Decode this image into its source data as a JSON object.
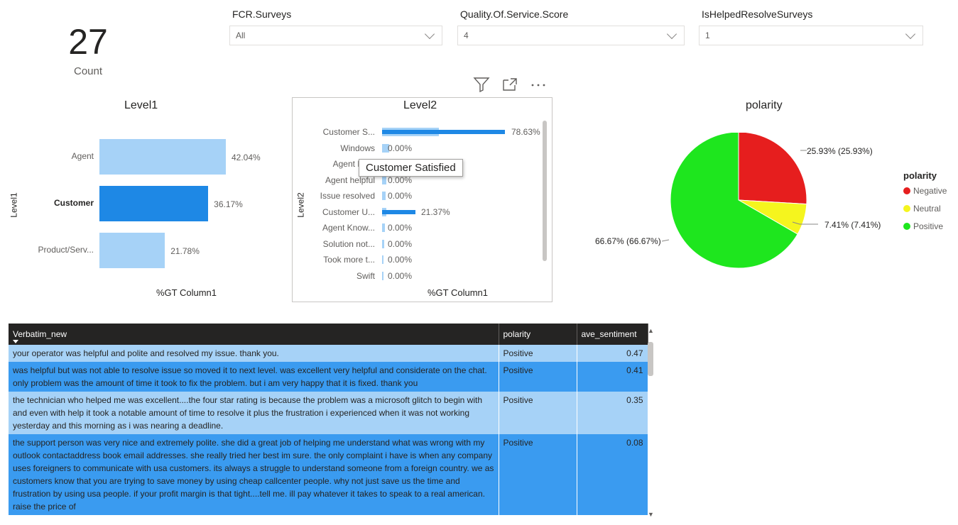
{
  "kpi": {
    "value": "27",
    "label": "Count"
  },
  "slicers": [
    {
      "title": "FCR.Surveys",
      "value": "All"
    },
    {
      "title": "Quality.Of.Service.Score",
      "value": "4"
    },
    {
      "title": "IsHelpedResolveSurveys",
      "value": "1"
    }
  ],
  "visual_header": {
    "icons": [
      "filter-icon",
      "focus-mode-icon",
      "more-options-icon"
    ]
  },
  "colors": {
    "bar_light": "#a6d2f7",
    "bar_highlight": "#1e88e5",
    "negative": "#e61e1e",
    "neutral": "#f5f51e",
    "positive": "#1ee61e"
  },
  "chart_data": [
    {
      "type": "bar",
      "title": "Level1",
      "xlabel": "%GT Column1",
      "ylabel": "Level1",
      "categories": [
        "Agent",
        "Customer",
        "Product/Serv..."
      ],
      "values": [
        42.04,
        36.17,
        21.78
      ],
      "data_labels": [
        "42.04%",
        "36.17%",
        "21.78%"
      ],
      "highlighted": "Customer"
    },
    {
      "type": "bar",
      "title": "Level2",
      "xlabel": "%GT Column1",
      "ylabel": "Level2",
      "categories": [
        "Customer S...",
        "Windows",
        "Agent Be...",
        "Agent helpful",
        "Issue resolved",
        "Customer U...",
        "Agent Know...",
        "Solution not...",
        "Took more t...",
        "Swift"
      ],
      "values": [
        78.63,
        0.0,
        0.0,
        0.0,
        0.0,
        21.37,
        0.0,
        0.0,
        0.0,
        0.0
      ],
      "data_labels": [
        "78.63%",
        "0.00%",
        "0.00%",
        "0.00%",
        "0.00%",
        "21.37%",
        "0.00%",
        "0.00%",
        "0.00%",
        "0.00%"
      ],
      "background_values": [
        100,
        12,
        8,
        7,
        6,
        8,
        5,
        4,
        3,
        2
      ],
      "tooltip": "Customer Satisfied"
    },
    {
      "type": "pie",
      "title": "polarity",
      "legend_title": "polarity",
      "legend_position": "right",
      "categories": [
        "Negative",
        "Neutral",
        "Positive"
      ],
      "values": [
        25.93,
        7.41,
        66.67
      ],
      "data_labels": [
        "25.93% (25.93%)",
        "7.41% (7.41%)",
        "66.67% (66.67%)"
      ],
      "colors": [
        "#e61e1e",
        "#f5f51e",
        "#1ee61e"
      ]
    }
  ],
  "table": {
    "columns": [
      "Verbatim_new",
      "polarity",
      "ave_sentiment"
    ],
    "rows": [
      {
        "verbatim": "your operator was helpful and polite and resolved my issue. thank you.",
        "polarity": "Positive",
        "ave_sentiment": "0.47"
      },
      {
        "verbatim": "was helpful but was not able to resolve issue so moved it to next level. was excellent very helpful and considerate on the chat. only problem was the amount of time it took to fix the problem. but i am very happy that it is fixed. thank you",
        "polarity": "Positive",
        "ave_sentiment": "0.41"
      },
      {
        "verbatim": "the technician who helped me was excellent....the four star rating is because the problem was a microsoft glitch to begin with and even with help it took a notable amount of time to resolve it plus the frustration i experienced when it was not working yesterday and this morning as i was nearing a deadline.",
        "polarity": "Positive",
        "ave_sentiment": "0.35"
      },
      {
        "verbatim": "the support person was very nice and extremely polite. she did a great job of helping me understand what was wrong with my outlook contactaddress book email addresses. she really tried her best im sure. the only complaint i have is when any company uses foreigners to communicate with usa customers. its always a struggle to understand someone from a foreign country. we as customers know that you are trying to save money by using cheap callcenter people. why not just save us the time and frustration by using usa people. if your profit margin is that tight....tell me. ill pay whatever it takes to speak to a real american. raise the price of",
        "polarity": "Positive",
        "ave_sentiment": "0.08"
      }
    ]
  }
}
